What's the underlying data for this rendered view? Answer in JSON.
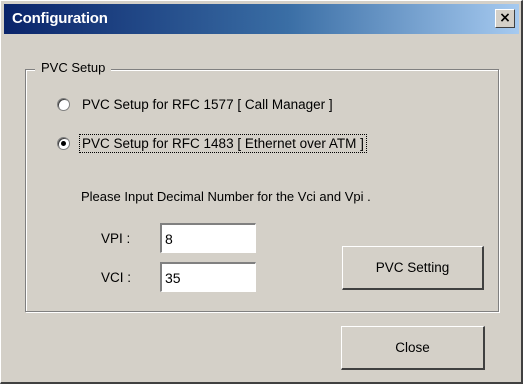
{
  "window": {
    "title": "Configuration",
    "close_glyph": "×"
  },
  "group": {
    "label": "PVC Setup"
  },
  "options": [
    {
      "label": "PVC Setup for RFC 1577  [ Call Manager ]",
      "checked": false
    },
    {
      "label": "PVC Setup for RFC 1483  [ Ethernet over ATM ]",
      "checked": true
    }
  ],
  "instruction": "Please Input Decimal  Number for the Vci and Vpi .",
  "vpi": {
    "label": "VPI :",
    "value": "8"
  },
  "vci": {
    "label": "VCI :",
    "value": "35"
  },
  "buttons": {
    "pvc_setting": "PVC Setting",
    "close": "Close"
  }
}
